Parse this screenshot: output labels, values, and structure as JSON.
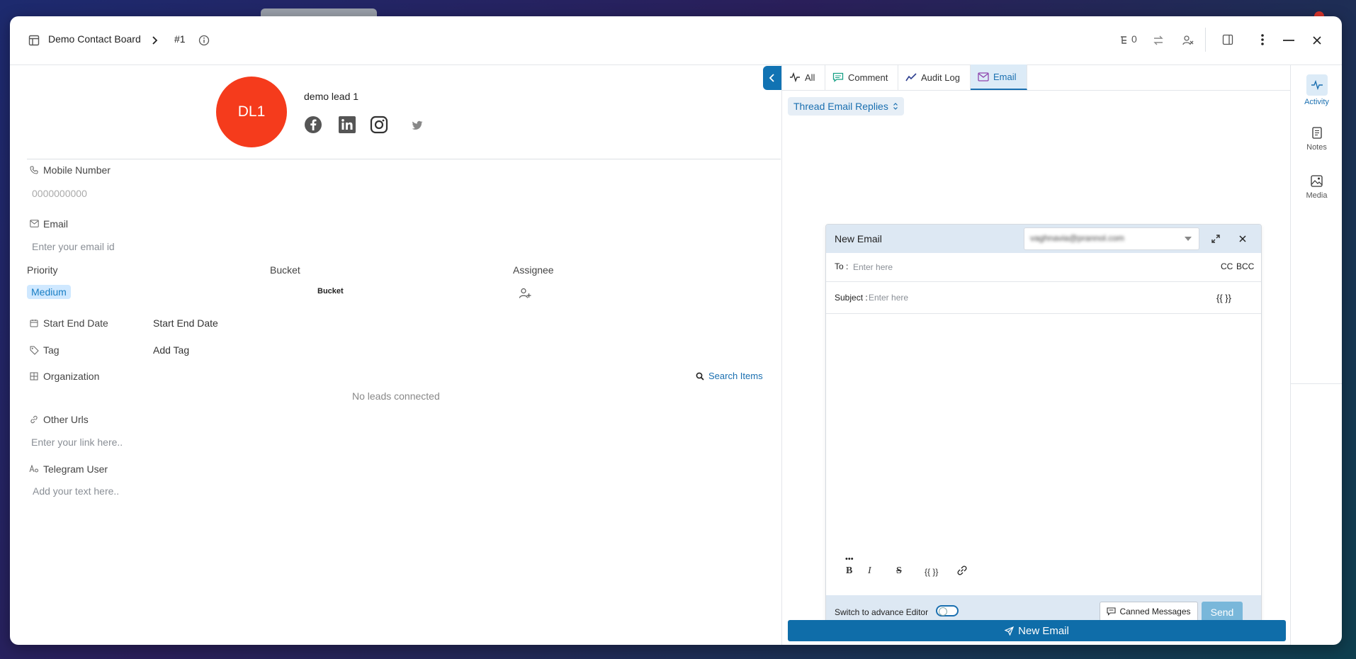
{
  "header": {
    "board_name": "Demo Contact Board",
    "record_id": "#1",
    "counter_value": "0"
  },
  "lead": {
    "initials": "DL1",
    "name": "demo lead 1",
    "avatar_color": "#f53b1c",
    "socials": [
      "facebook-icon",
      "linkedin-icon",
      "instagram-icon",
      "twitter-icon"
    ]
  },
  "fields": {
    "mobile_label": "Mobile Number",
    "mobile_value": "0000000000",
    "email_label": "Email",
    "email_placeholder": "Enter your email id",
    "priority_label": "Priority",
    "priority_value": "Medium",
    "bucket_label": "Bucket",
    "bucket_value": "Bucket",
    "assignee_label": "Assignee",
    "start_end_label": "Start End Date",
    "start_end_value": "Start End Date",
    "tag_label": "Tag",
    "tag_value": "Add Tag",
    "organization_label": "Organization",
    "search_items": "Search Items",
    "no_leads": "No leads connected",
    "other_urls_label": "Other Urls",
    "other_urls_placeholder": "Enter your link here..",
    "telegram_label": "Telegram User",
    "telegram_placeholder": "Add your text here.."
  },
  "activity_tabs": [
    {
      "label": "All",
      "icon": "activity-icon"
    },
    {
      "label": "Comment",
      "icon": "comment-icon"
    },
    {
      "label": "Audit Log",
      "icon": "trend-icon"
    },
    {
      "label": "Email",
      "icon": "mail-icon",
      "active": true
    }
  ],
  "thread_selector": "Thread Email Replies",
  "compose": {
    "title": "New Email",
    "from_value": "vaghnavia@prannol.com",
    "to_label": "To :",
    "to_placeholder": "Enter here",
    "cc_label": "CC",
    "bcc_label": "BCC",
    "subject_label": "Subject :",
    "subject_placeholder": "Enter here",
    "variables_label": "{{ }}",
    "more_label": "•••",
    "bold_label": "B",
    "italic_label": "I",
    "strike_label": "S",
    "var_btn_label": "{{ }}",
    "advance_editor_label": "Switch to advance Editor",
    "canned_label": "Canned Messages",
    "send_label": "Send"
  },
  "new_email_button": "New Email",
  "right_sidebar": {
    "items": [
      {
        "label": "Activity",
        "icon": "activity-icon",
        "active": true
      },
      {
        "label": "Notes",
        "icon": "notes-icon"
      },
      {
        "label": "Media",
        "icon": "media-icon"
      }
    ]
  },
  "colors": {
    "accent": "#1a6fb0",
    "primary_button": "#0f6da9",
    "avatar": "#f53b1c",
    "badge_bg": "#cfe8ff"
  }
}
